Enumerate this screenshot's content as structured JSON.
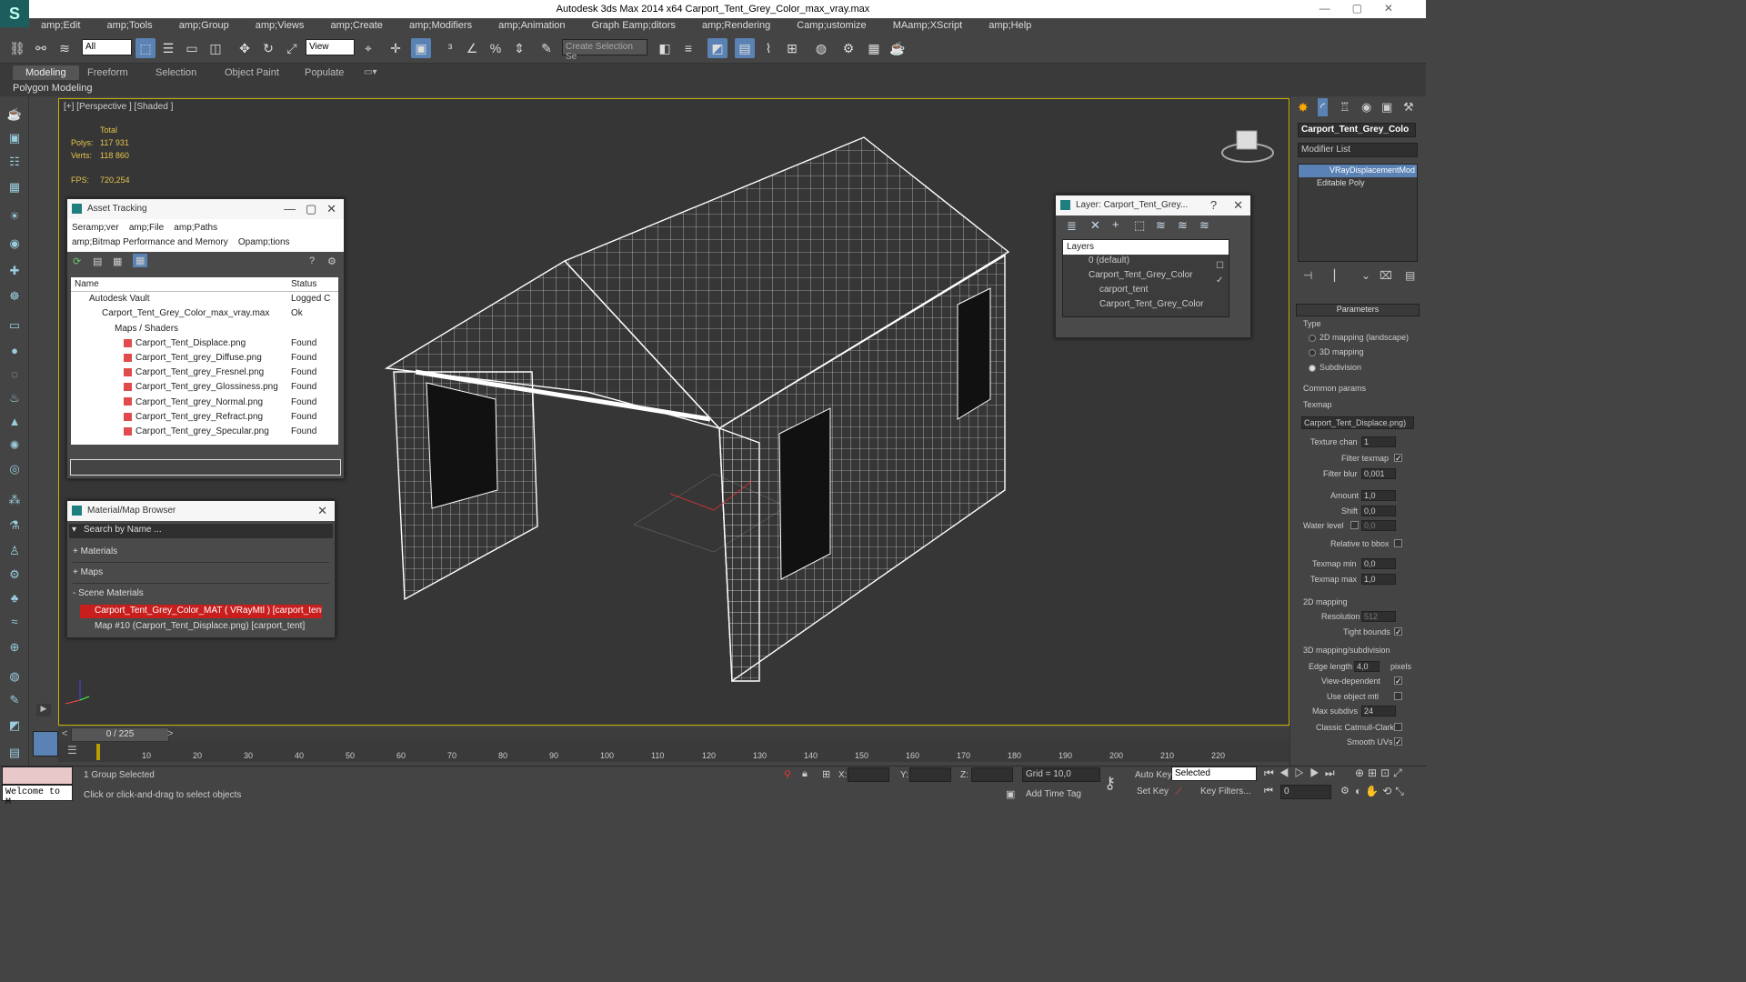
{
  "window": {
    "title": "Autodesk 3ds Max  2014 x64     Carport_Tent_Grey_Color_max_vray.max"
  },
  "menu": [
    "amp;Edit",
    "amp;Tools",
    "amp;Group",
    "amp;Views",
    "amp;Create",
    "amp;Modifiers",
    "amp;Animation",
    "Graph Eamp;ditors",
    "amp;Rendering",
    "Camp;ustomize",
    "MAamp;XScript",
    "amp;Help"
  ],
  "toolbar": {
    "selection_filter": "All",
    "ref_coord": "View",
    "named_selection": "Create Selection Se"
  },
  "ribbon": {
    "tabs": [
      "Modeling",
      "Freeform",
      "Selection",
      "Object Paint",
      "Populate"
    ],
    "sub": "Polygon Modeling"
  },
  "viewport": {
    "label": "[+] [Perspective ] [Shaded ]",
    "stats": {
      "total_label": "Total",
      "polys_label": "Polys:",
      "polys": "117 931",
      "verts_label": "Verts:",
      "verts": "118 860",
      "fps_label": "FPS:",
      "fps": "720,254"
    }
  },
  "asset_tracking": {
    "title": "Asset Tracking",
    "menu1": [
      "Seramp;ver",
      "amp;File",
      "amp;Paths"
    ],
    "menu2": [
      "amp;Bitmap Performance and Memory",
      "Opamp;tions"
    ],
    "col_name": "Name",
    "col_status": "Status",
    "rows": [
      {
        "name": "Autodesk Vault",
        "status": "Logged C"
      },
      {
        "name": "Carport_Tent_Grey_Color_max_vray.max",
        "status": "Ok"
      },
      {
        "name": "Maps / Shaders",
        "status": ""
      },
      {
        "name": "Carport_Tent_Displace.png",
        "status": "Found"
      },
      {
        "name": "Carport_Tent_grey_Diffuse.png",
        "status": "Found"
      },
      {
        "name": "Carport_Tent_grey_Fresnel.png",
        "status": "Found"
      },
      {
        "name": "Carport_Tent_grey_Glossiness.png",
        "status": "Found"
      },
      {
        "name": "Carport_Tent_grey_Normal.png",
        "status": "Found"
      },
      {
        "name": "Carport_Tent_grey_Refract.png",
        "status": "Found"
      },
      {
        "name": "Carport_Tent_grey_Specular.png",
        "status": "Found"
      }
    ]
  },
  "material_browser": {
    "title": "Material/Map Browser",
    "search_placeholder": "Search by Name ...",
    "groups": [
      "+ Materials",
      "+ Maps",
      "- Scene Materials"
    ],
    "items": [
      "Carport_Tent_Grey_Color_MAT  ( VRayMtl )  [carport_tent]",
      "Map #10 (Carport_Tent_Displace.png)  [carport_tent]"
    ]
  },
  "layer_panel": {
    "title": "Layer: Carport_Tent_Grey...",
    "header": "Layers",
    "items": [
      "0 (default)",
      "Carport_Tent_Grey_Color",
      "carport_tent",
      "Carport_Tent_Grey_Color"
    ]
  },
  "modify": {
    "object_name": "Carport_Tent_Grey_Colo",
    "modifier_list": "Modifier List",
    "stack": [
      "VRayDisplacementMod",
      "Editable Poly"
    ],
    "rollout": "Parameters",
    "type_label": "Type",
    "types": [
      "2D mapping (landscape)",
      "3D mapping",
      "Subdivision"
    ],
    "common": "Common params",
    "texmap_label": "Texmap",
    "texmap": "Carport_Tent_Displace.png)",
    "texture_chan_label": "Texture chan",
    "texture_chan": "1",
    "filter_texmap": "Filter texmap",
    "filter_blur_label": "Filter blur",
    "filter_blur": "0,001",
    "amount_label": "Amount",
    "amount": "1,0",
    "shift_label": "Shift",
    "shift": "0,0",
    "water_label": "Water level",
    "water": "0,0",
    "relative_bbox": "Relative to bbox",
    "texmap_min_label": "Texmap min",
    "texmap_min": "0,0",
    "texmap_max_label": "Texmap max",
    "texmap_max": "1,0",
    "mapping2d": "2D mapping",
    "resolution_label": "Resolution",
    "resolution": "512",
    "tight_bounds": "Tight bounds",
    "mapping3d": "3D mapping/subdivision",
    "edge_length_label": "Edge length",
    "edge_length": "4,0",
    "pixels": "pixels",
    "view_dependent": "View-dependent",
    "use_object_mtl": "Use object mtl",
    "max_subdivs_label": "Max subdivs",
    "max_subdivs": "24",
    "classic_catmull": "Classic Catmull-Clark",
    "smooth_uvs": "Smooth UVs"
  },
  "timeline": {
    "frame": "0 / 225",
    "ticks": [
      "10",
      "20",
      "30",
      "40",
      "50",
      "60",
      "70",
      "80",
      "90",
      "100",
      "110",
      "120",
      "130",
      "140",
      "150",
      "160",
      "170",
      "180",
      "190",
      "200",
      "210",
      "220"
    ]
  },
  "status": {
    "welcome": "Welcome to M",
    "selected": "1 Group Selected",
    "prompt": "Click or click-and-drag to select objects",
    "x_label": "X:",
    "y_label": "Y:",
    "z_label": "Z:",
    "grid": "Grid = 10,0",
    "add_time_tag": "Add Time Tag",
    "auto_key": "Auto Key",
    "set_key": "Set Key",
    "key_mode": "Selected",
    "key_filters": "Key Filters...",
    "frame_field": "0"
  }
}
